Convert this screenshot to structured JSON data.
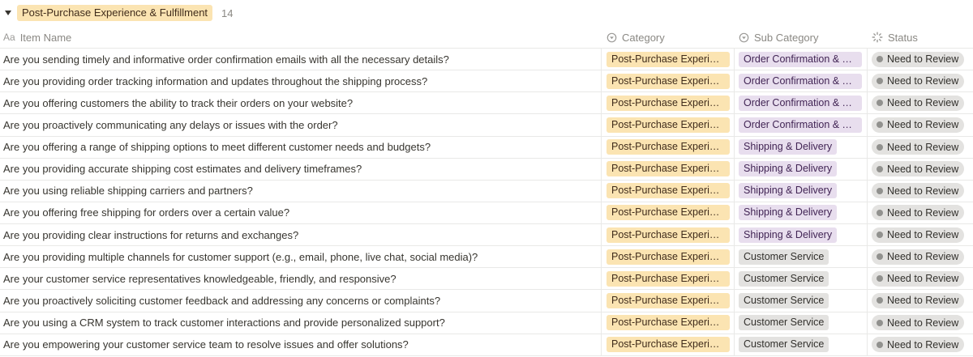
{
  "group": {
    "title": "Post-Purchase Experience & Fulfillment",
    "count": "14"
  },
  "columns": {
    "name_icon": "Aa",
    "name": "Item Name",
    "category": "Category",
    "subcategory": "Sub Category",
    "status": "Status"
  },
  "rows": [
    {
      "name": "Are you sending timely and informative order confirmation emails with all the necessary details?",
      "category": "Post-Purchase Experience ...",
      "subcategory": "Order Confirmation & Tra...",
      "sub_color": "purple",
      "status": "Need to Review"
    },
    {
      "name": "Are you providing order tracking information and updates throughout the shipping process?",
      "category": "Post-Purchase Experience ...",
      "subcategory": "Order Confirmation & Tra...",
      "sub_color": "purple",
      "status": "Need to Review"
    },
    {
      "name": "Are you offering customers the ability to track their orders on your website?",
      "category": "Post-Purchase Experience ...",
      "subcategory": "Order Confirmation & Tra...",
      "sub_color": "purple",
      "status": "Need to Review"
    },
    {
      "name": "Are you proactively communicating any delays or issues with the order?",
      "category": "Post-Purchase Experience ...",
      "subcategory": "Order Confirmation & Tra...",
      "sub_color": "purple",
      "status": "Need to Review"
    },
    {
      "name": "Are you offering a range of shipping options to meet different customer needs and budgets?",
      "category": "Post-Purchase Experience ...",
      "subcategory": "Shipping & Delivery",
      "sub_color": "purple",
      "status": "Need to Review"
    },
    {
      "name": "Are you providing accurate shipping cost estimates and delivery timeframes?",
      "category": "Post-Purchase Experience ...",
      "subcategory": "Shipping & Delivery",
      "sub_color": "purple",
      "status": "Need to Review"
    },
    {
      "name": "Are you using reliable shipping carriers and partners?",
      "category": "Post-Purchase Experience ...",
      "subcategory": "Shipping & Delivery",
      "sub_color": "purple",
      "status": "Need to Review"
    },
    {
      "name": "Are you offering free shipping for orders over a certain value?",
      "category": "Post-Purchase Experience ...",
      "subcategory": "Shipping & Delivery",
      "sub_color": "purple",
      "status": "Need to Review"
    },
    {
      "name": "Are you providing clear instructions for returns and exchanges?",
      "category": "Post-Purchase Experience ...",
      "subcategory": "Shipping & Delivery",
      "sub_color": "purple",
      "status": "Need to Review"
    },
    {
      "name": "Are you providing multiple channels for customer support (e.g., email, phone, live chat, social media)?",
      "category": "Post-Purchase Experience ...",
      "subcategory": "Customer Service",
      "sub_color": "gray",
      "status": "Need to Review"
    },
    {
      "name": "Are your customer service representatives knowledgeable, friendly, and responsive?",
      "category": "Post-Purchase Experience ...",
      "subcategory": "Customer Service",
      "sub_color": "gray",
      "status": "Need to Review"
    },
    {
      "name": "Are you proactively soliciting customer feedback and addressing any concerns or complaints?",
      "category": "Post-Purchase Experience ...",
      "subcategory": "Customer Service",
      "sub_color": "gray",
      "status": "Need to Review"
    },
    {
      "name": "Are you using a CRM system to track customer interactions and provide personalized support?",
      "category": "Post-Purchase Experience ...",
      "subcategory": "Customer Service",
      "sub_color": "gray",
      "status": "Need to Review"
    },
    {
      "name": "Are you empowering your customer service team to resolve issues and offer solutions?",
      "category": "Post-Purchase Experience ...",
      "subcategory": "Customer Service",
      "sub_color": "gray",
      "status": "Need to Review"
    }
  ],
  "colors": {
    "category_tag": "#fbe4b2",
    "sub_purple": "#e8deee",
    "sub_gray": "#e3e2e0",
    "status_dot": "#91918e"
  }
}
